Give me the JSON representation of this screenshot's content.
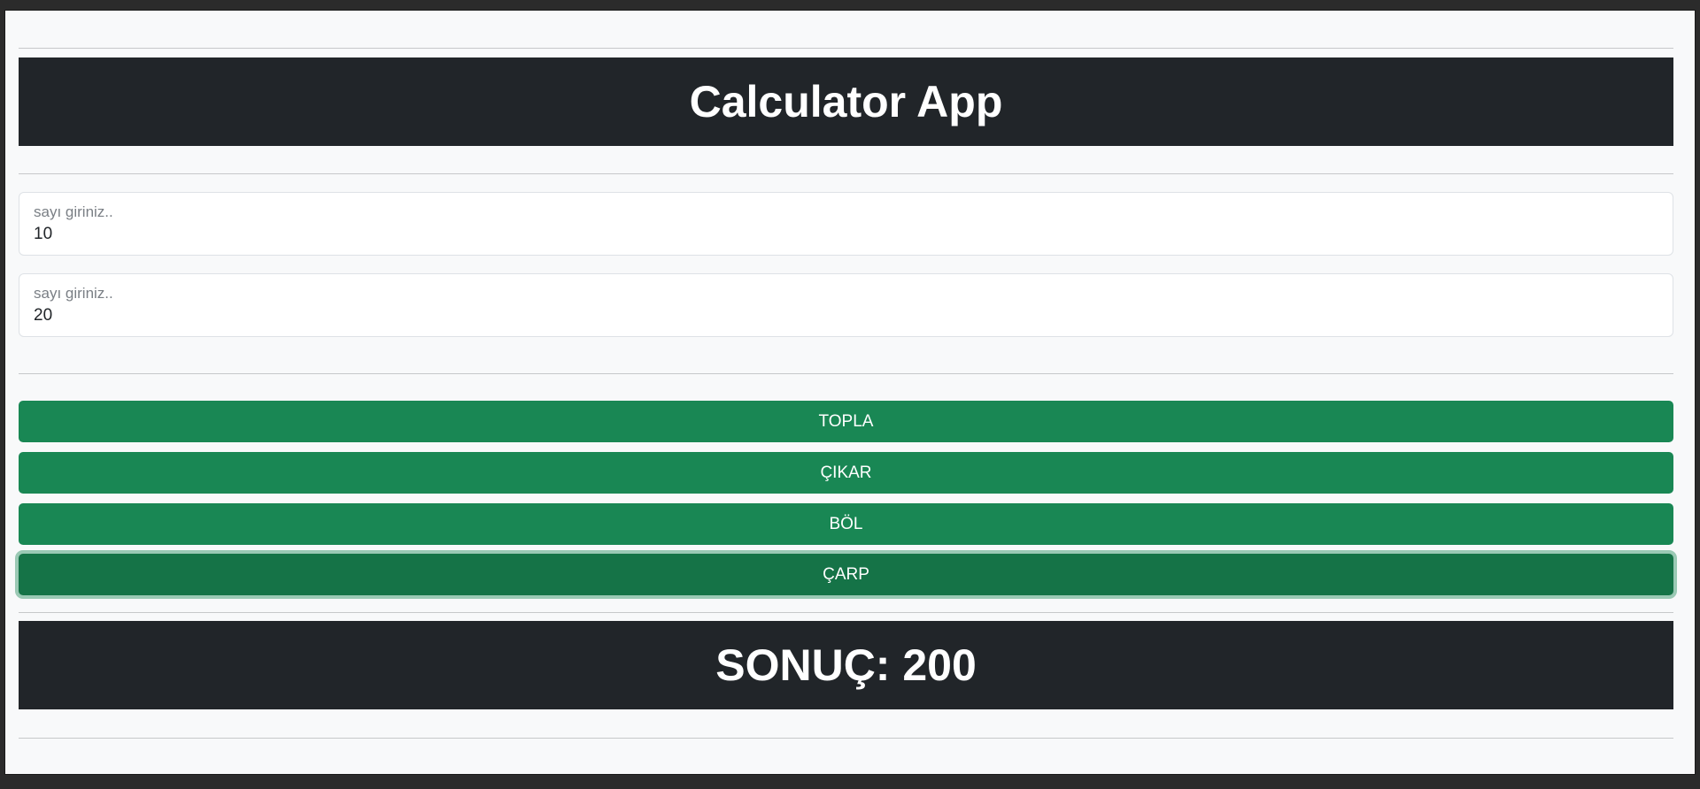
{
  "app": {
    "title": "Calculator App"
  },
  "inputs": [
    {
      "label": "sayı giriniz..",
      "value": "10"
    },
    {
      "label": "sayı giriniz..",
      "value": "20"
    }
  ],
  "buttons": {
    "add": "TOPLA",
    "subtract": "ÇIKAR",
    "divide": "BÖL",
    "multiply": "ÇARP"
  },
  "result": {
    "text": "SONUÇ: 200"
  },
  "colors": {
    "banner": "#212529",
    "button": "#198754",
    "button_focused": "#157347",
    "background": "#f8f9fa"
  }
}
